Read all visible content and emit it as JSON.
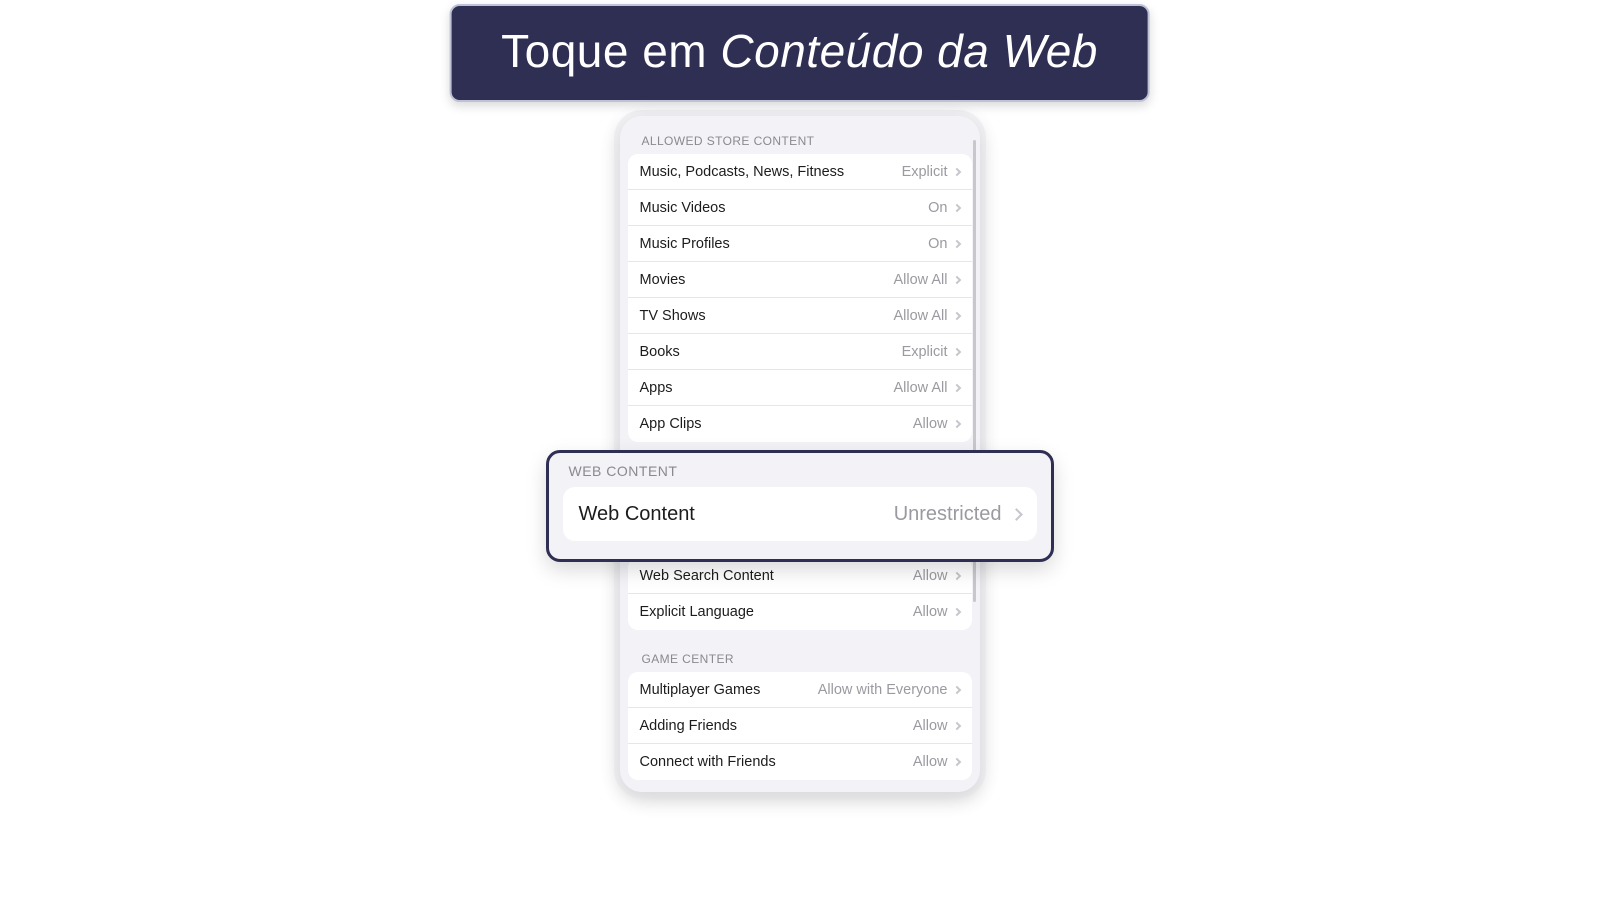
{
  "instruction": {
    "prefix": "Toque em ",
    "target": "Conteúdo da Web"
  },
  "sections": {
    "allowed_store": {
      "header": "ALLOWED STORE CONTENT",
      "rows": [
        {
          "label": "Music, Podcasts, News, Fitness",
          "value": "Explicit"
        },
        {
          "label": "Music Videos",
          "value": "On"
        },
        {
          "label": "Music Profiles",
          "value": "On"
        },
        {
          "label": "Movies",
          "value": "Allow All"
        },
        {
          "label": "TV Shows",
          "value": "Allow All"
        },
        {
          "label": "Books",
          "value": "Explicit"
        },
        {
          "label": "Apps",
          "value": "Allow All"
        },
        {
          "label": "App Clips",
          "value": "Allow"
        }
      ]
    },
    "web_content": {
      "header": "WEB CONTENT",
      "row": {
        "label": "Web Content",
        "value": "Unrestricted"
      }
    },
    "siri": {
      "rows": [
        {
          "label": "Web Search Content",
          "value": "Allow"
        },
        {
          "label": "Explicit Language",
          "value": "Allow"
        }
      ]
    },
    "game_center": {
      "header": "GAME CENTER",
      "rows": [
        {
          "label": "Multiplayer Games",
          "value": "Allow with Everyone"
        },
        {
          "label": "Adding Friends",
          "value": "Allow"
        },
        {
          "label": "Connect with Friends",
          "value": "Allow"
        }
      ]
    }
  }
}
